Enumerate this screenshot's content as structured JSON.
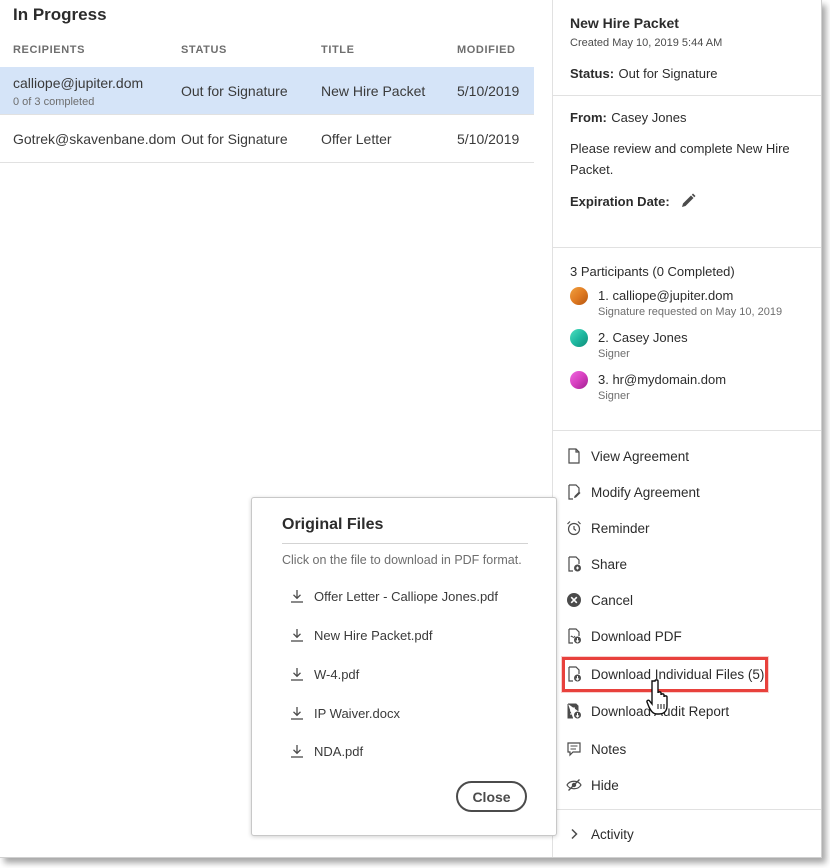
{
  "list": {
    "title": "In Progress",
    "columns": [
      "RECIPIENTS",
      "STATUS",
      "TITLE",
      "MODIFIED"
    ],
    "rows": [
      {
        "recipient": "calliope@jupiter.dom",
        "progress": "0 of 3 completed",
        "status": "Out for Signature",
        "title": "New Hire Packet",
        "modified": "5/10/2019",
        "selected": true
      },
      {
        "recipient": "Gotrek@skavenbane.dom",
        "progress": "",
        "status": "Out for Signature",
        "title": "Offer Letter",
        "modified": "5/10/2019",
        "selected": false
      }
    ]
  },
  "detail": {
    "doc_name": "New Hire Packet",
    "created": "Created May 10, 2019 5:44 AM",
    "status_label": "Status:",
    "status_value": "Out for Signature",
    "from_label": "From:",
    "from_value": "Casey Jones",
    "message": "Please review and complete New Hire Packet.",
    "expiration_label": "Expiration Date:",
    "participants_header": "3 Participants (0 Completed)",
    "participants": [
      {
        "name": "1. calliope@jupiter.dom",
        "role": "Signature requested on May 10, 2019",
        "color": "#e07b22"
      },
      {
        "name": "2. Casey Jones",
        "role": "Signer",
        "color": "#1eb8a0"
      },
      {
        "name": "3. hr@mydomain.dom",
        "role": "Signer",
        "color": "#d63fbf"
      }
    ],
    "actions": [
      {
        "label": "View Agreement",
        "icon": "document-icon"
      },
      {
        "label": "Modify Agreement",
        "icon": "edit-document-icon"
      },
      {
        "label": "Reminder",
        "icon": "alarm-clock-icon"
      },
      {
        "label": "Share",
        "icon": "share-document-icon"
      },
      {
        "label": "Cancel",
        "icon": "cancel-circle-icon"
      },
      {
        "label": "Download PDF",
        "icon": "pdf-download-icon"
      },
      {
        "label": "Download Individual Files (5)",
        "icon": "file-download-icon"
      },
      {
        "label": "Download Audit Report",
        "icon": "audit-report-icon"
      },
      {
        "label": "Notes",
        "icon": "notes-icon"
      },
      {
        "label": "Hide",
        "icon": "hide-eye-icon"
      }
    ],
    "activity_label": "Activity",
    "highlight_color": "#e8413c"
  },
  "modal": {
    "title": "Original Files",
    "description": "Click on the file to download in PDF format.",
    "files": [
      "Offer Letter - Calliope Jones.pdf",
      "New Hire Packet.pdf",
      "W-4.pdf",
      "IP Waiver.docx",
      "NDA.pdf"
    ],
    "close_label": "Close"
  }
}
